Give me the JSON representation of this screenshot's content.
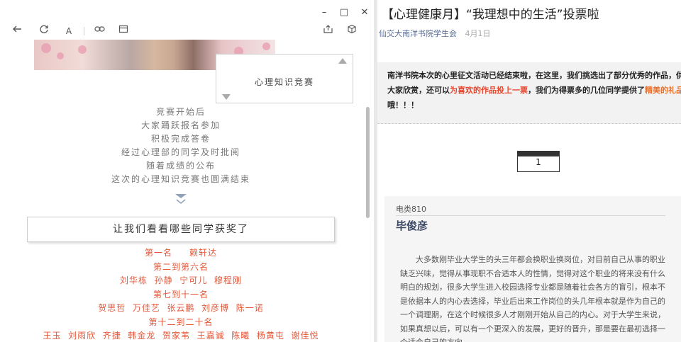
{
  "left": {
    "window_buttons": {
      "minimize": "–",
      "maximize": "□",
      "close": "✕"
    },
    "quiz_title": "心理知识竞赛",
    "poem_lines": [
      "竞赛开始后",
      "大家踊跃报名参加",
      "积极完成答卷",
      "经过心理部的同学及时批阅",
      "随着成绩的公布",
      "这次的心理知识竞赛也圆满结束"
    ],
    "award_heading": "让我们看看哪些同学获奖了",
    "award_lines": [
      "第一名     赖轩达",
      "第二到第六名",
      "刘华栋  孙静  宁可儿  穆程刚",
      "第七到十一名",
      "贺思哲  万佳艺  张云鹏  刘彦博  陈一诺",
      "第十二到二十名",
      "王玉  刘雨欣  齐捷  韩金龙  贺家苇  王嘉诚  陈曦  杨黄屯  谢佳悦"
    ]
  },
  "right": {
    "title": "【心理健康月】“我理想中的生活”投票啦",
    "author": "仙交大南洋书院学生会",
    "date": "4月1日",
    "intro": {
      "part1": "南洋书院本次的心里征文活动已经结束啦，在这里，我们挑选出了部分优秀的作品，供大家欣赏，还可以",
      "highlight1": "为喜欢的作品投上一票",
      "part2": "，我们为得票多的几位同学提供了",
      "highlight2": "精美的礼品",
      "part3": "哦！！！"
    },
    "vote_number": "1",
    "card": {
      "category": "电类810",
      "name": "毕俊彦",
      "body": "大多数刚毕业大学生的头三年都会换职业换岗位，对目前自己从事的职业缺乏兴味，觉得从事现职不合适本人的性情，觉得对这个职业的将来没有什么明白的规划，很多大学生进入校园选择专业都是随着社会各方的盲引，根本不是依据本人的内心去选择，毕业后出来工作岗位的头几年根本就是作为自己的一个调理期，在这个时候很多人才刚刚开始从自己的内心。对于大学生来说，如果真想以后，可以有一个更深入的发展，更好的晋升，那是要在最初选择一个适合自己的方向"
    }
  },
  "colors": {
    "accent_red": "#e3573a",
    "link_blue": "#576b95",
    "highlight_red": "#e8472f"
  }
}
